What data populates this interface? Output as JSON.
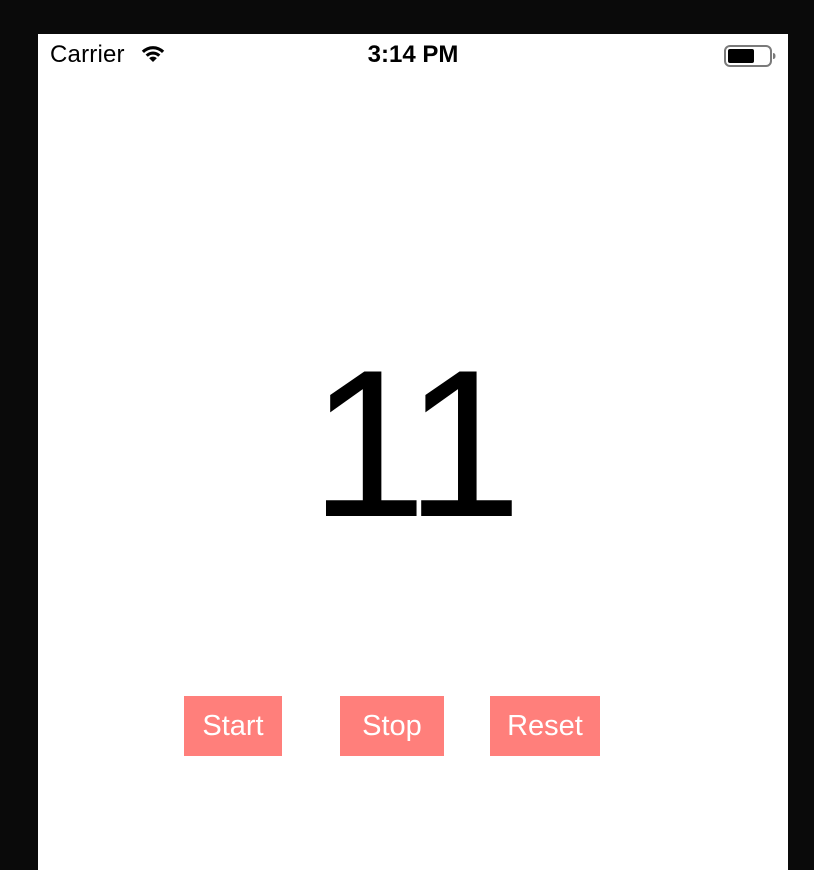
{
  "status_bar": {
    "carrier": "Carrier",
    "time": "3:14 PM",
    "wifi_icon": "wifi-icon",
    "battery_icon": "battery-icon"
  },
  "timer": {
    "value": "11"
  },
  "controls": {
    "start_label": "Start",
    "stop_label": "Stop",
    "reset_label": "Reset"
  },
  "colors": {
    "button_bg": "#ff7f7b",
    "button_text": "#ffffff",
    "screen_bg": "#ffffff",
    "outer_bg": "#0a0a0a"
  }
}
